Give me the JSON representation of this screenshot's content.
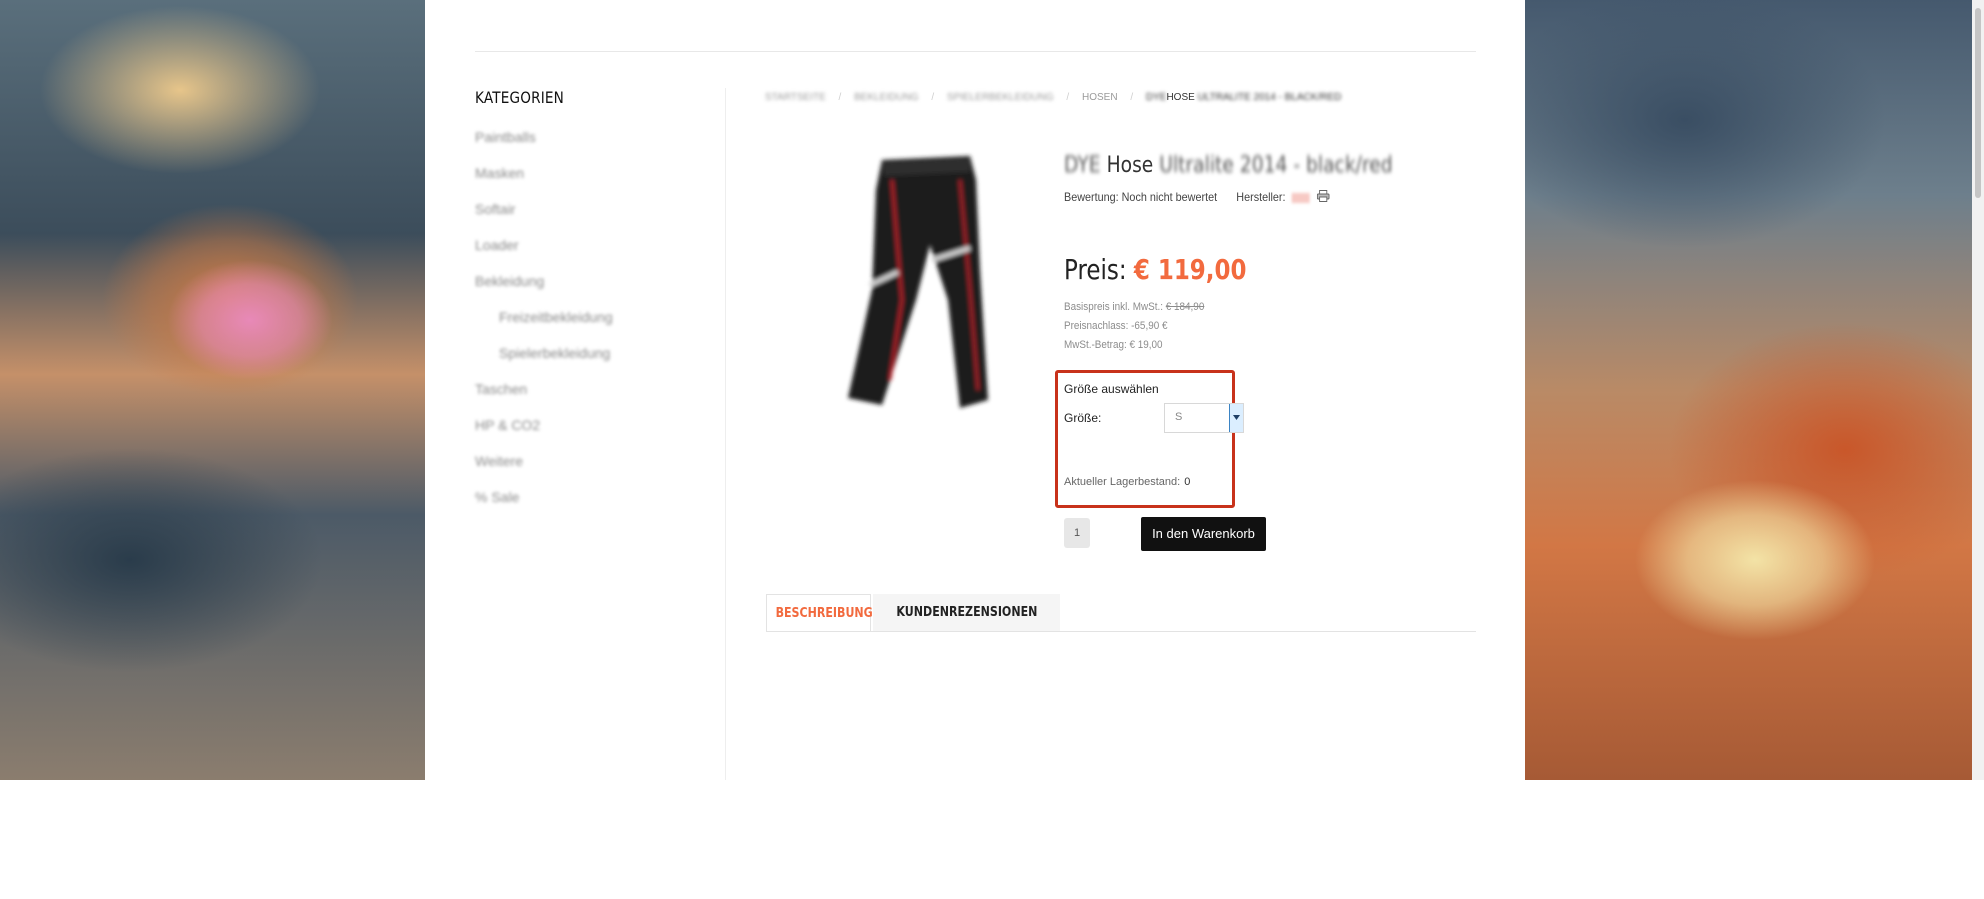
{
  "sidebar": {
    "title": "KATEGORIEN",
    "items": [
      {
        "label": "Paintballs"
      },
      {
        "label": "Masken"
      },
      {
        "label": "Softair"
      },
      {
        "label": "Loader"
      },
      {
        "label": "Bekleidung"
      },
      {
        "label": "Freizeitbekleidung"
      },
      {
        "label": "Spielerbekleidung"
      },
      {
        "label": "Taschen"
      },
      {
        "label": "HP & CO2"
      },
      {
        "label": "Weitere"
      },
      {
        "label": "% Sale"
      }
    ]
  },
  "breadcrumb": {
    "items": [
      "STARTSEITE",
      "BEKLEIDUNG",
      "SPIELERBEKLEIDUNG",
      "HOSEN"
    ],
    "current_prefix": "DYE",
    "current_main": "HOSE",
    "current_suffix": "ULTRALITE 2014 - BLACK/RED",
    "separator": "/"
  },
  "product": {
    "title_prefix": "DYE",
    "title_main": "Hose",
    "title_suffix": "Ultralite 2014 - black/red",
    "rating_label": "Bewertung: Noch nicht bewertet",
    "manufacturer_label": "Hersteller:",
    "price_label": "Preis:",
    "price": "€ 119,00",
    "base_price_label": "Basispreis inkl. MwSt.:",
    "base_price": "€ 184,90",
    "discount": "Preisnachlass: -65,90 €",
    "tax": "MwSt.-Betrag: € 19,00"
  },
  "variant": {
    "title": "Größe auswählen",
    "size_label": "Größe:",
    "size_value": "S",
    "stock_label": "Aktueller Lagerbestand:",
    "stock_value": "0"
  },
  "cart": {
    "quantity": "1",
    "button_label": "In den Warenkorb"
  },
  "tabs": [
    {
      "label": "BESCHREIBUNG"
    },
    {
      "label": "KUNDENREZENSIONEN"
    }
  ],
  "colors": {
    "accent": "#f26a3e",
    "highlight_border": "#c8321b",
    "button": "#111111"
  }
}
